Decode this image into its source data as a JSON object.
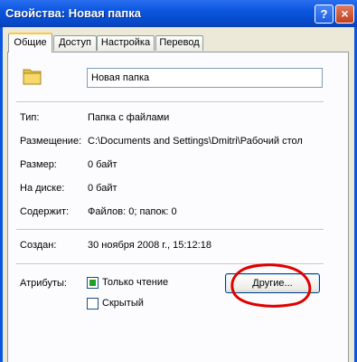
{
  "window": {
    "title": "Свойства: Новая папка",
    "help_label": "?",
    "close_label": "×"
  },
  "tabs": [
    {
      "label": "Общие",
      "active": true
    },
    {
      "label": "Доступ",
      "active": false
    },
    {
      "label": "Настройка",
      "active": false
    },
    {
      "label": "Перевод",
      "active": false
    }
  ],
  "general": {
    "icon": "folder-icon",
    "name_value": "Новая папка",
    "rows": [
      {
        "label": "Тип:",
        "value": "Папка с файлами"
      },
      {
        "label": "Размещение:",
        "value": "C:\\Documents and Settings\\Dmitri\\Рабочий стол"
      },
      {
        "label": "Размер:",
        "value": "0 байт"
      },
      {
        "label": "На диске:",
        "value": "0 байт"
      },
      {
        "label": "Содержит:",
        "value": "Файлов: 0; папок: 0"
      }
    ],
    "created_label": "Создан:",
    "created_value": "30 ноября 2008 г., 15:12:18",
    "attributes_label": "Атрибуты:",
    "readonly_label": "Только чтение",
    "readonly_checked": true,
    "hidden_label": "Скрытый",
    "hidden_checked": false,
    "advanced_button": "Другие..."
  },
  "colors": {
    "title_bar": "#0a56de",
    "annotation": "#e00000",
    "tab_highlight": "#ffc83c"
  }
}
